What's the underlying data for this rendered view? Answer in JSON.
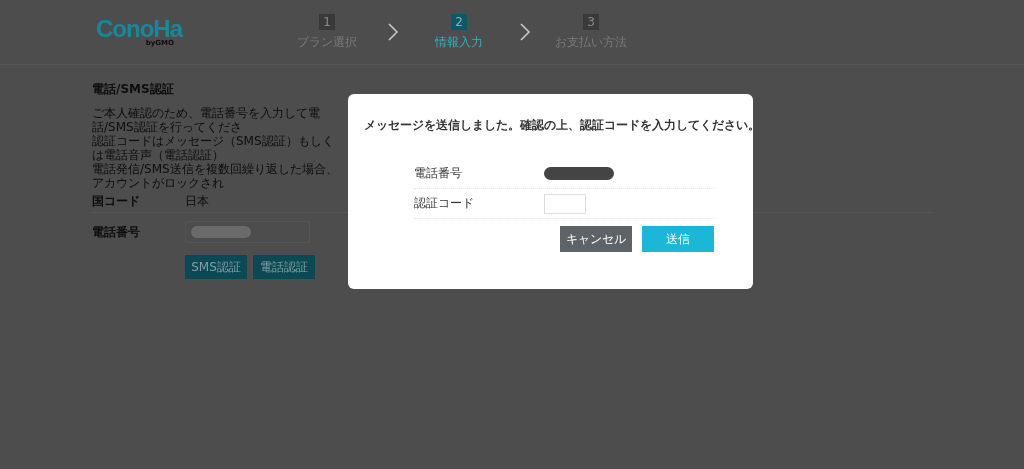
{
  "header": {
    "logo": "ConoHa",
    "logo_sub": "byGMO",
    "steps": [
      {
        "number": "1",
        "label": "プラン選択",
        "selected": false
      },
      {
        "number": "2",
        "label": "情報入力",
        "selected": true
      },
      {
        "number": "3",
        "label": "お支払い方法",
        "selected": false
      }
    ]
  },
  "section": {
    "title": "電話/SMS認証",
    "notes": [
      "ご本人確認のため、電話番号を入力して電話/SMS認証を行ってくださ",
      "認証コードはメッセージ（SMS認証）もしくは電話音声（電話認証）",
      "電話発信/SMS送信を複数回繰り返した場合、アカウントがロックされ"
    ],
    "country": {
      "label": "国コード",
      "value": "日本"
    },
    "phone": {
      "label": "電話番号"
    },
    "buttons": [
      "SMS認証",
      "電話認証"
    ]
  },
  "dialog": {
    "message": "メッセージを送信しました。確認の上、認証コードを入力してください。",
    "phone_label": "電話番号",
    "code_label": "認証コード",
    "buttons": [
      {
        "label": "キャンセル",
        "kind": "secondary"
      },
      {
        "label": "送信",
        "kind": "primary"
      }
    ]
  }
}
